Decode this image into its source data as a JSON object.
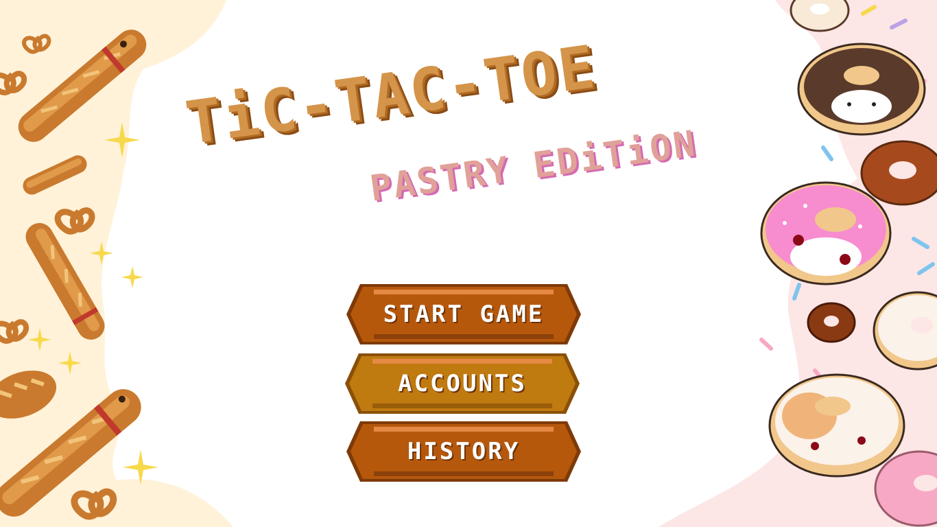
{
  "title": {
    "main": "TiC-TAC-TOE",
    "sub": "PASTRY EDiTiON"
  },
  "menu": {
    "items": [
      {
        "label": "START GAME"
      },
      {
        "label": "ACCOUNTS"
      },
      {
        "label": "HISTORY"
      }
    ]
  },
  "colors": {
    "title_fill": "#d4944a",
    "title_shadow": "#b06a22",
    "subtitle_fill": "#e0a199",
    "subtitle_shadow": "#d46ab2",
    "button_start": "#b6580c",
    "button_accounts": "#bf7a10",
    "button_history": "#b6580c",
    "button_highlight": "#e58a45",
    "button_dark": "#7e3a08",
    "left_blob": "#fff2d9",
    "right_blob": "#fde6e6"
  },
  "decorations": {
    "left": [
      "baguette-icon",
      "pretzel-icon",
      "sparkle-icon",
      "bread-loaf-icon"
    ],
    "right": [
      "cat-donut-icon",
      "donut-icon",
      "sprinkle-icon"
    ]
  }
}
